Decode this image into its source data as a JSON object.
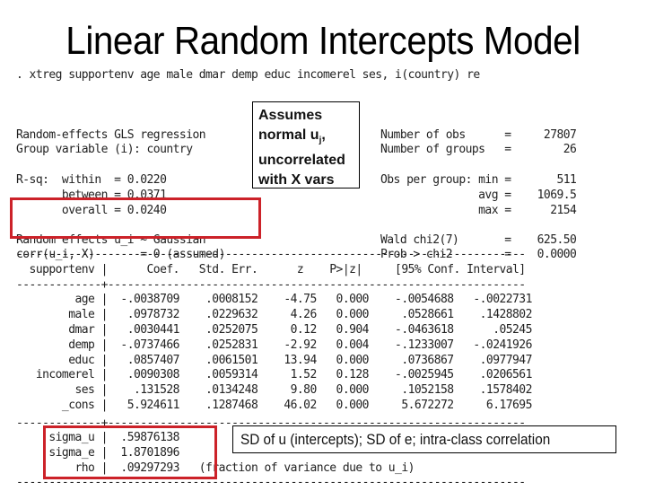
{
  "slide": {
    "title": "Linear Random Intercepts Model"
  },
  "command": ". xtreg supportenv age male dmar demp educ incomerel ses, i(country) re",
  "header": {
    "left": [
      "Random-effects GLS regression",
      "Group variable (i): country",
      "",
      "R-sq:  within  = 0.0220",
      "       between = 0.0371",
      "       overall = 0.0240"
    ],
    "right": [
      "Number of obs      =     27807",
      "Number of groups   =        26",
      "",
      "Obs per group: min =       511",
      "               avg =    1069.5",
      "               max =      2154"
    ]
  },
  "random_effects": {
    "left": [
      "Random effects u_i ~ Gaussian",
      "corr(u_i, X)       = 0 (assumed)"
    ],
    "right": [
      "Wald chi2(7)       =    625.50",
      "Prob > chi2        =    0.0000"
    ]
  },
  "table": {
    "dash_line": "------------------------------------------------------------------------------",
    "sep_line": "-------------+----------------------------------------------------------------",
    "columns": [
      "supportenv",
      "Coef.",
      "Std. Err.",
      "z",
      "P>|z|",
      "[95% Conf. Interval]"
    ],
    "header_line": "  supportenv |      Coef.   Std. Err.      z    P>|z|     [95% Conf. Interval]",
    "rows": [
      {
        "var": "age",
        "coef": "-.0038709",
        "se": ".0008152",
        "z": "-4.75",
        "p": "0.000",
        "lo": "-.0054688",
        "hi": "-.0022731"
      },
      {
        "var": "male",
        "coef": ".0978732",
        "se": ".0229632",
        "z": "4.26",
        "p": "0.000",
        "lo": ".0528661",
        "hi": ".1428802"
      },
      {
        "var": "dmar",
        "coef": ".0030441",
        "se": ".0252075",
        "z": "0.12",
        "p": "0.904",
        "lo": "-.0463618",
        "hi": ".05245"
      },
      {
        "var": "demp",
        "coef": "-.0737466",
        "se": ".0252831",
        "z": "-2.92",
        "p": "0.004",
        "lo": "-.1233007",
        "hi": "-.0241926"
      },
      {
        "var": "educ",
        "coef": ".0857407",
        "se": ".0061501",
        "z": "13.94",
        "p": "0.000",
        "lo": ".0736867",
        "hi": ".0977947"
      },
      {
        "var": "incomerel",
        "coef": ".0090308",
        "se": ".0059314",
        "z": "1.52",
        "p": "0.128",
        "lo": "-.0025945",
        "hi": ".0206561"
      },
      {
        "var": "ses",
        "coef": ".131528",
        "se": ".0134248",
        "z": "9.80",
        "p": "0.000",
        "lo": ".1052158",
        "hi": ".1578402"
      },
      {
        "var": "_cons",
        "coef": "5.924611",
        "se": ".1287468",
        "z": "46.02",
        "p": "0.000",
        "lo": "5.672272",
        "hi": "6.17695"
      }
    ],
    "aux_rows": [
      {
        "var": "sigma_u",
        "value": ".59876138",
        "note": ""
      },
      {
        "var": "sigma_e",
        "value": "1.8701896",
        "note": ""
      },
      {
        "var": "rho",
        "value": ".09297293",
        "note": "(fraction of variance due to u_i)"
      }
    ]
  },
  "callouts": {
    "assumption_lines": [
      "Assumes",
      "normal u",
      "j",
      ",",
      "uncorrelated",
      "with X vars"
    ],
    "sd_note": "SD of u (intercepts); SD of e; intra-class correlation"
  },
  "colors": {
    "highlight_box": "#cc2229",
    "text": "#222222"
  }
}
